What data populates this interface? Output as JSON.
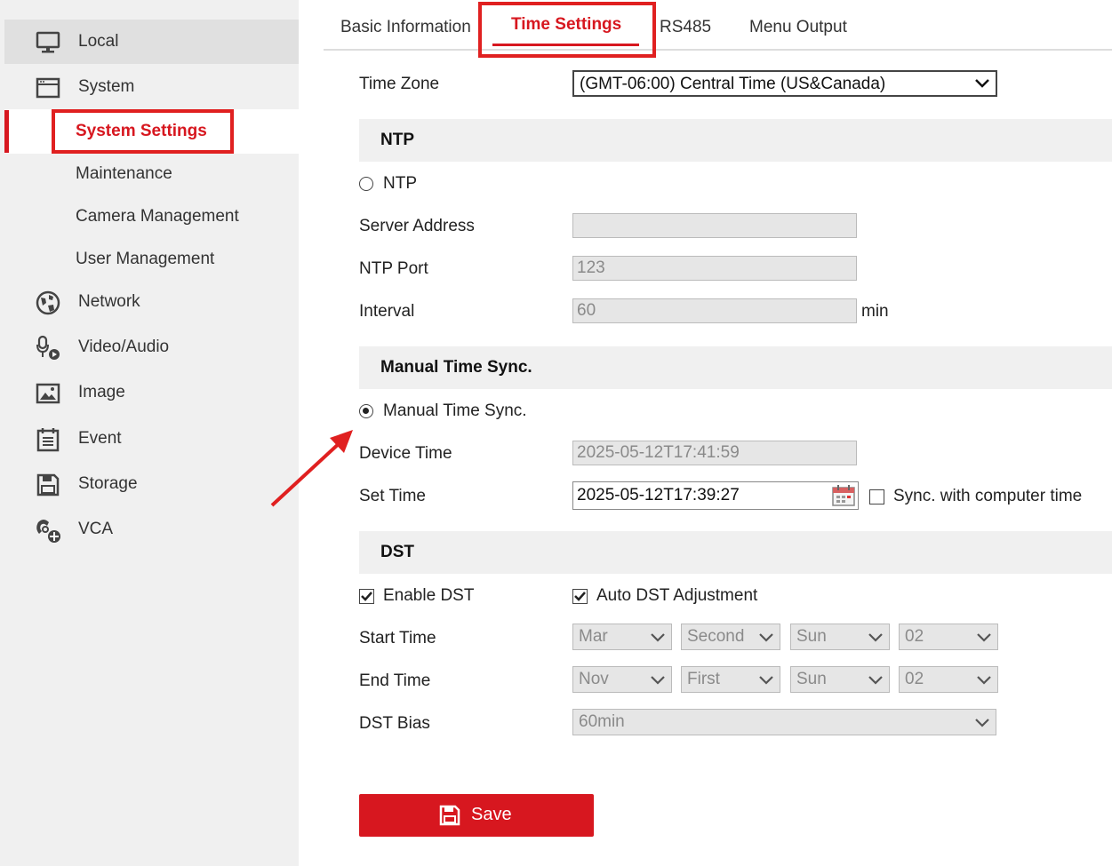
{
  "sidebar": {
    "items": [
      {
        "label": "Local"
      },
      {
        "label": "System"
      },
      {
        "label": "System Settings"
      },
      {
        "label": "Maintenance"
      },
      {
        "label": "Camera Management"
      },
      {
        "label": "User Management"
      },
      {
        "label": "Network"
      },
      {
        "label": "Video/Audio"
      },
      {
        "label": "Image"
      },
      {
        "label": "Event"
      },
      {
        "label": "Storage"
      },
      {
        "label": "VCA"
      }
    ]
  },
  "tabs": [
    {
      "label": "Basic Information"
    },
    {
      "label": "Time Settings"
    },
    {
      "label": "RS485"
    },
    {
      "label": "Menu Output"
    }
  ],
  "form": {
    "time_zone_label": "Time Zone",
    "time_zone_value": "(GMT-06:00) Central Time (US&Canada)",
    "ntp_section": "NTP",
    "ntp_radio_label": "NTP",
    "server_address_label": "Server Address",
    "server_address_value": "",
    "ntp_port_label": "NTP Port",
    "ntp_port_value": "123",
    "interval_label": "Interval",
    "interval_value": "60",
    "interval_unit": "min",
    "manual_section": "Manual Time Sync.",
    "manual_radio_label": "Manual Time Sync.",
    "device_time_label": "Device Time",
    "device_time_value": "2025-05-12T17:41:59",
    "set_time_label": "Set Time",
    "set_time_value": "2025-05-12T17:39:27",
    "sync_computer_label": "Sync. with computer time",
    "dst_section": "DST",
    "enable_dst_label": "Enable DST",
    "auto_dst_label": "Auto DST Adjustment",
    "start_time_label": "Start Time",
    "start_time": [
      "Mar",
      "Second",
      "Sun",
      "02"
    ],
    "end_time_label": "End Time",
    "end_time": [
      "Nov",
      "First",
      "Sun",
      "02"
    ],
    "dst_bias_label": "DST Bias",
    "dst_bias_value": "60min",
    "save_label": "Save"
  },
  "colors": {
    "accent": "#d7171f",
    "sidebar_bg": "#f0f0f0",
    "section_bg": "#f0f0f0"
  }
}
